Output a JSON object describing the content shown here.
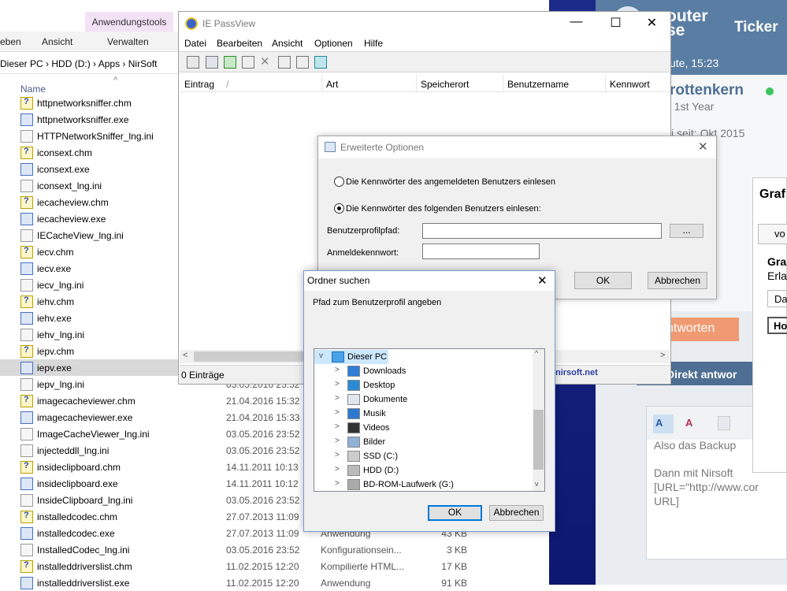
{
  "explorer": {
    "ribbon_tabs": [
      "eben",
      "Ansicht",
      "Verwalten"
    ],
    "context_tab": "Anwendungstools",
    "address": [
      "Dieser PC",
      "HDD (D:)",
      "Apps",
      "NirSoft"
    ],
    "name_header": "Name",
    "files": [
      {
        "name": "httpnetworksniffer.chm",
        "type": "chm",
        "date": "",
        "kind": "",
        "size": ""
      },
      {
        "name": "httpnetworksniffer.exe",
        "type": "exe",
        "date": "",
        "kind": "",
        "size": ""
      },
      {
        "name": "HTTPNetworkSniffer_lng.ini",
        "type": "ini",
        "date": "",
        "kind": "",
        "size": ""
      },
      {
        "name": "iconsext.chm",
        "type": "chm",
        "date": "",
        "kind": "",
        "size": ""
      },
      {
        "name": "iconsext.exe",
        "type": "exe",
        "date": "",
        "kind": "",
        "size": ""
      },
      {
        "name": "iconsext_lng.ini",
        "type": "ini",
        "date": "",
        "kind": "",
        "size": ""
      },
      {
        "name": "iecacheview.chm",
        "type": "chm",
        "date": "",
        "kind": "",
        "size": ""
      },
      {
        "name": "iecacheview.exe",
        "type": "exe",
        "date": "",
        "kind": "",
        "size": ""
      },
      {
        "name": "IECacheView_lng.ini",
        "type": "ini",
        "date": "",
        "kind": "",
        "size": ""
      },
      {
        "name": "iecv.chm",
        "type": "chm",
        "date": "",
        "kind": "",
        "size": ""
      },
      {
        "name": "iecv.exe",
        "type": "exe",
        "date": "",
        "kind": "",
        "size": ""
      },
      {
        "name": "iecv_lng.ini",
        "type": "ini",
        "date": "",
        "kind": "",
        "size": ""
      },
      {
        "name": "iehv.chm",
        "type": "chm",
        "date": "",
        "kind": "",
        "size": ""
      },
      {
        "name": "iehv.exe",
        "type": "exe",
        "date": "",
        "kind": "",
        "size": ""
      },
      {
        "name": "iehv_lng.ini",
        "type": "ini",
        "date": "",
        "kind": "",
        "size": ""
      },
      {
        "name": "iepv.chm",
        "type": "chm",
        "date": "",
        "kind": "",
        "size": ""
      },
      {
        "name": "iepv.exe",
        "type": "exe",
        "date": "",
        "kind": "",
        "size": "",
        "selected": true
      },
      {
        "name": "iepv_lng.ini",
        "type": "ini",
        "date": "03.05.2016 23:52",
        "kind": "",
        "size": ""
      },
      {
        "name": "imagecacheviewer.chm",
        "type": "chm",
        "date": "21.04.2016 15:32",
        "kind": "",
        "size": ""
      },
      {
        "name": "imagecacheviewer.exe",
        "type": "exe",
        "date": "21.04.2016 15:33",
        "kind": "",
        "size": ""
      },
      {
        "name": "ImageCacheViewer_lng.ini",
        "type": "ini",
        "date": "03.05.2016 23:52",
        "kind": "",
        "size": ""
      },
      {
        "name": "injecteddll_lng.ini",
        "type": "ini",
        "date": "03.05.2016 23:52",
        "kind": "",
        "size": ""
      },
      {
        "name": "insideclipboard.chm",
        "type": "chm",
        "date": "14.11.2011 10:13",
        "kind": "",
        "size": ""
      },
      {
        "name": "insideclipboard.exe",
        "type": "exe",
        "date": "14.11.2011 10:12",
        "kind": "",
        "size": ""
      },
      {
        "name": "InsideClipboard_lng.ini",
        "type": "ini",
        "date": "03.05.2016 23:52",
        "kind": "",
        "size": ""
      },
      {
        "name": "installedcodec.chm",
        "type": "chm",
        "date": "27.07.2013 11:09",
        "kind": "",
        "size": ""
      },
      {
        "name": "installedcodec.exe",
        "type": "exe",
        "date": "27.07.2013 11:09",
        "kind": "Anwendung",
        "size": "43 KB"
      },
      {
        "name": "InstalledCodec_lng.ini",
        "type": "ini",
        "date": "03.05.2016 23:52",
        "kind": "Konfigurationsein...",
        "size": "3 KB"
      },
      {
        "name": "installeddriverslist.chm",
        "type": "chm",
        "date": "11.02.2015 12:20",
        "kind": "Kompilierte HTML...",
        "size": "17 KB"
      },
      {
        "name": "installeddriverslist.exe",
        "type": "exe",
        "date": "11.02.2015 12:20",
        "kind": "Anwendung",
        "size": "91 KB"
      }
    ]
  },
  "web": {
    "logo": [
      "outer",
      "se"
    ],
    "ticker": "Ticker",
    "time": "ute, 15:23",
    "user": "rottenkern",
    "rank": "t 1st Year",
    "member_since": "i seit: Okt 2015",
    "reply": "ntworten",
    "direkt": "Direkt antwor",
    "link": "nirsoft.net",
    "editor_lines": [
      "Also das Backup",
      "Dann mit Nirsoft",
      "[URL=\"http://www.cor",
      "URL]"
    ],
    "side_panel": [
      "Graf",
      "vo",
      "Gra",
      "Erla",
      "Da",
      "Ho"
    ]
  },
  "iepv": {
    "title": "IE PassView",
    "menu": [
      "Datei",
      "Bearbeiten",
      "Ansicht",
      "Optionen",
      "Hilfe"
    ],
    "columns": [
      "Eintrag",
      "Art",
      "Speicherort",
      "Benutzername",
      "Kennwort"
    ],
    "status": "0 Einträge",
    "controls": {
      "minimize": "—",
      "maximize": "☐",
      "close": "✕"
    }
  },
  "erw": {
    "title": "Erweiterte Optionen",
    "radio1": "Die Kennwörter des angemeldeten Benutzers einlesen",
    "radio2": "Die Kennwörter des folgenden Benutzers einlesen:",
    "profile_label": "Benutzerprofilpfad:",
    "profile_value": "",
    "browse": "...",
    "password_label": "Anmeldekennwort:",
    "password_value": "",
    "ok": "OK",
    "cancel": "Abbrechen"
  },
  "ord": {
    "title": "Ordner suchen",
    "prompt": "Pfad zum Benutzerprofil angeben",
    "root": "Dieser PC",
    "nodes": [
      "Downloads",
      "Desktop",
      "Dokumente",
      "Musik",
      "Videos",
      "Bilder",
      "SSD (C:)",
      "HDD (D:)",
      "BD-ROM-Laufwerk (G:)"
    ],
    "ok": "OK",
    "cancel": "Abbrechen"
  }
}
